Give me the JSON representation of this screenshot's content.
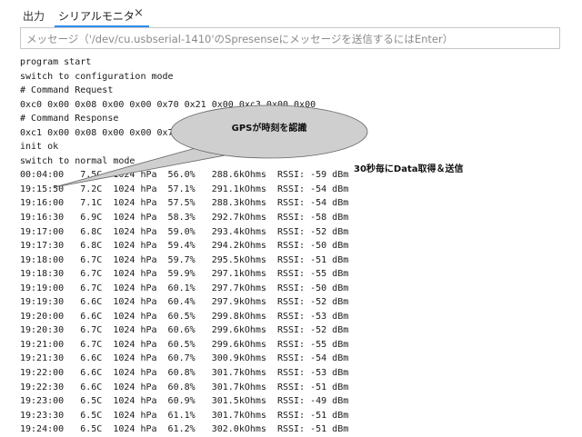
{
  "tabs": {
    "output": "出力",
    "serial": "シリアルモニタ",
    "close": "×"
  },
  "message_input": {
    "placeholder": "メッセージ（'/dev/cu.usbserial-1410'のSpresenseにメッセージを送信するにはEnter）"
  },
  "log_lines": [
    "program start",
    "switch to configuration mode",
    "# Command Request",
    "0xc0 0x00 0x08 0x00 0x00 0x70 0x21 0x00 0xc3 0x00 0x00",
    "# Command Response",
    "0xc1 0x00 0x08 0x00 0x00 0x70 0x21 0x00 0xc3 0x00 0x00",
    "init ok",
    "switch to normal mode",
    "00:04:00   7.5C  1024 hPa  56.0%   288.6kOhms  RSSI: -59 dBm",
    "19:15:50   7.2C  1024 hPa  57.1%   291.1kOhms  RSSI: -54 dBm",
    "19:16:00   7.1C  1024 hPa  57.5%   288.3kOhms  RSSI: -54 dBm",
    "19:16:30   6.9C  1024 hPa  58.3%   292.7kOhms  RSSI: -58 dBm",
    "19:17:00   6.8C  1024 hPa  59.0%   293.4kOhms  RSSI: -52 dBm",
    "19:17:30   6.8C  1024 hPa  59.4%   294.2kOhms  RSSI: -50 dBm",
    "19:18:00   6.7C  1024 hPa  59.7%   295.5kOhms  RSSI: -51 dBm",
    "19:18:30   6.7C  1024 hPa  59.9%   297.1kOhms  RSSI: -55 dBm",
    "19:19:00   6.7C  1024 hPa  60.1%   297.7kOhms  RSSI: -50 dBm",
    "19:19:30   6.6C  1024 hPa  60.4%   297.9kOhms  RSSI: -52 dBm",
    "19:20:00   6.6C  1024 hPa  60.5%   299.8kOhms  RSSI: -53 dBm",
    "19:20:30   6.7C  1024 hPa  60.6%   299.6kOhms  RSSI: -52 dBm",
    "19:21:00   6.7C  1024 hPa  60.5%   299.6kOhms  RSSI: -55 dBm",
    "19:21:30   6.6C  1024 hPa  60.7%   300.9kOhms  RSSI: -54 dBm",
    "19:22:00   6.6C  1024 hPa  60.8%   301.7kOhms  RSSI: -53 dBm",
    "19:22:30   6.6C  1024 hPa  60.8%   301.7kOhms  RSSI: -51 dBm",
    "19:23:00   6.5C  1024 hPa  60.9%   301.5kOhms  RSSI: -49 dBm",
    "19:23:30   6.5C  1024 hPa  61.1%   301.7kOhms  RSSI: -51 dBm",
    "19:24:00   6.5C  1024 hPa  61.2%   302.0kOhms  RSSI: -51 dBm"
  ],
  "annotations": {
    "gps_bubble": "GPSが時刻を認識",
    "interval_note": "30秒毎にData取得＆送信"
  },
  "colors": {
    "tab_accent": "#2f8cf0",
    "bubble_fill": "#cfcfcf"
  }
}
